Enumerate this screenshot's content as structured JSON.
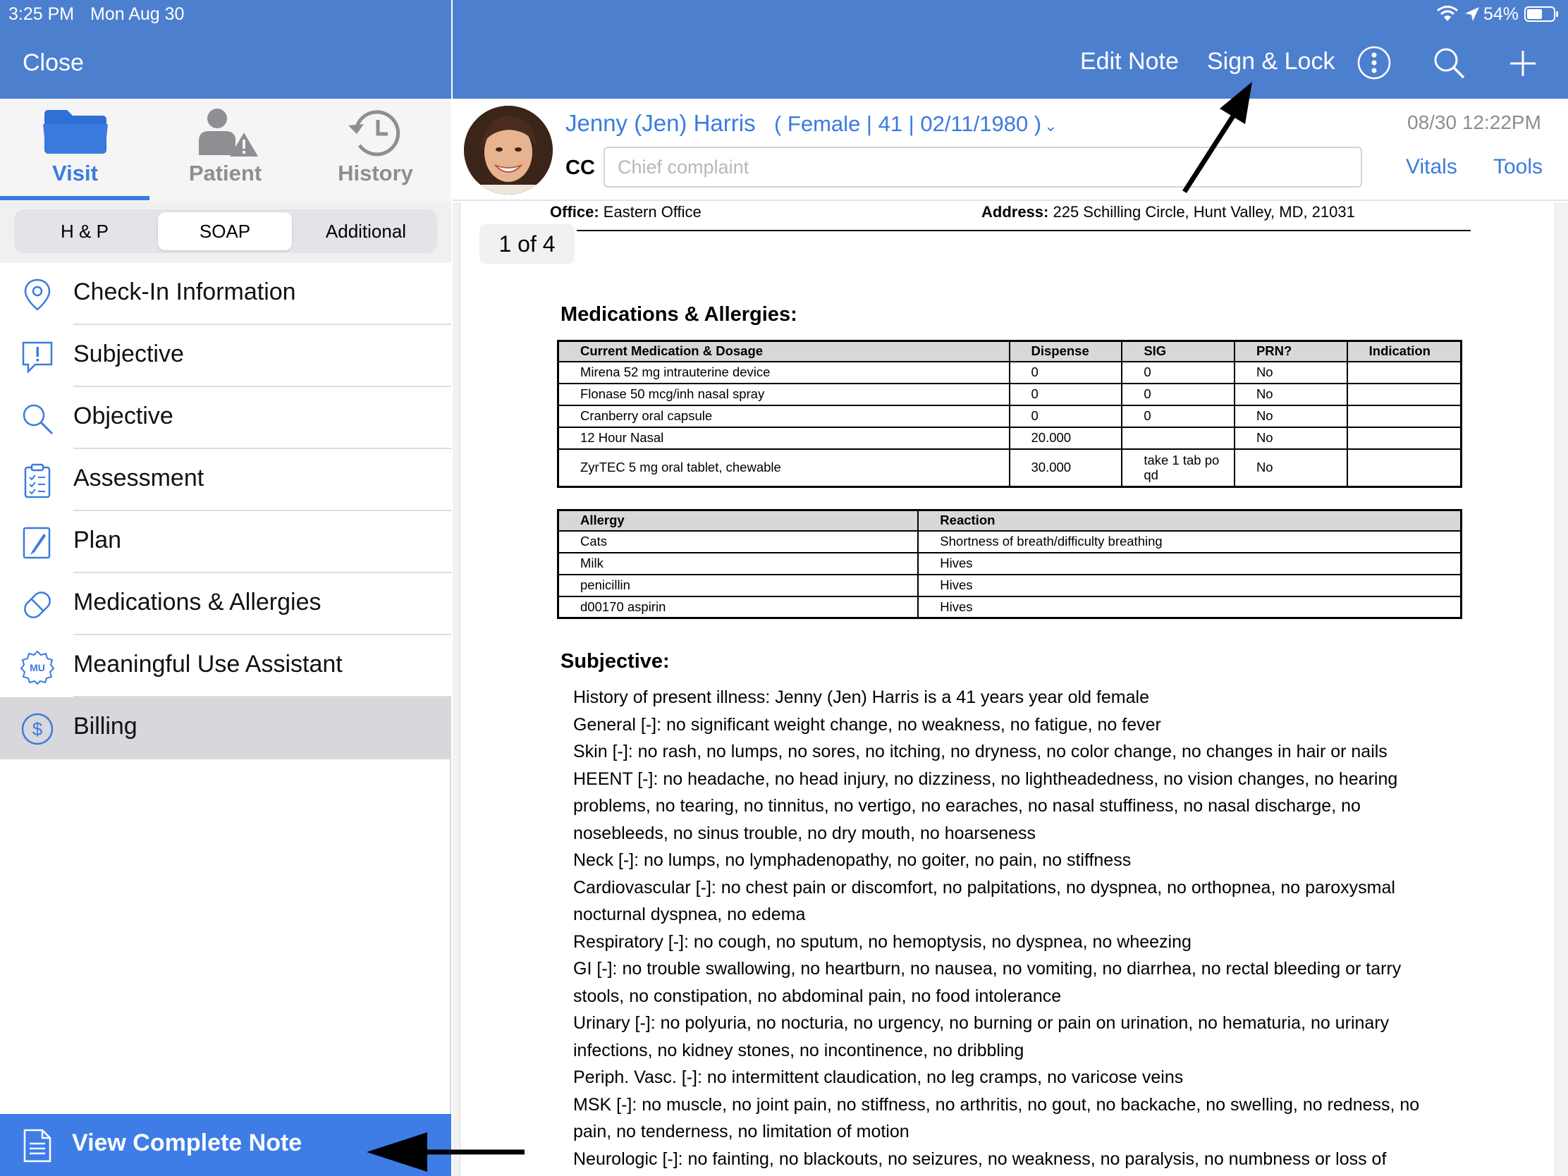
{
  "status": {
    "time": "3:25 PM",
    "date": "Mon Aug 30",
    "battery": "54%"
  },
  "left": {
    "close_label": "Close",
    "tabs": [
      {
        "label": "Visit"
      },
      {
        "label": "Patient"
      },
      {
        "label": "History"
      }
    ],
    "segments": [
      {
        "label": "H & P"
      },
      {
        "label": "SOAP"
      },
      {
        "label": "Additional"
      }
    ],
    "selected_segment": "SOAP",
    "nav_items": [
      {
        "label": "Check-In Information",
        "icon": "location-pin-icon"
      },
      {
        "label": "Subjective",
        "icon": "speech-bubble-exclamation-icon"
      },
      {
        "label": "Objective",
        "icon": "magnifier-icon"
      },
      {
        "label": "Assessment",
        "icon": "clipboard-checklist-icon"
      },
      {
        "label": "Plan",
        "icon": "pen-icon"
      },
      {
        "label": "Medications & Allergies",
        "icon": "pill-icon"
      },
      {
        "label": "Meaningful Use Assistant",
        "icon": "mu-badge-icon"
      },
      {
        "label": "Billing",
        "icon": "dollar-circle-icon"
      }
    ],
    "selected_nav": "Billing",
    "view_note_label": "View Complete Note"
  },
  "header": {
    "edit_note": "Edit Note",
    "sign_lock": "Sign & Lock"
  },
  "patient": {
    "name": "Jenny (Jen) Harris",
    "demographics": "( Female | 41 | 02/11/1980 )",
    "visit_datetime": "08/30 12:22PM",
    "cc_label": "CC",
    "cc_placeholder": "Chief complaint",
    "vitals_label": "Vitals",
    "tools_label": "Tools"
  },
  "doc": {
    "page_indicator": "1 of 4",
    "office_label": "Office:",
    "office_value": " Eastern Office",
    "address_label": "Address:",
    "address_value": " 225 Schilling Circle, Hunt Valley, MD, 21031",
    "med_title": "Medications & Allergies:",
    "med_headers": [
      "Current Medication & Dosage",
      "Dispense",
      "SIG",
      "PRN?",
      "Indication"
    ],
    "meds": [
      [
        "Mirena 52 mg intrauterine device",
        "0",
        "0",
        "No",
        ""
      ],
      [
        "Flonase 50 mcg/inh nasal spray",
        "0",
        "0",
        "No",
        ""
      ],
      [
        "Cranberry oral capsule",
        "0",
        "0",
        "No",
        ""
      ],
      [
        "12 Hour Nasal",
        "20.000",
        "",
        "No",
        ""
      ],
      [
        "ZyrTEC 5 mg oral tablet, chewable",
        "30.000",
        "take 1 tab po qd",
        "No",
        ""
      ]
    ],
    "allergy_headers": [
      "Allergy",
      "Reaction"
    ],
    "allergies": [
      [
        "Cats",
        "Shortness of breath/difficulty breathing"
      ],
      [
        "Milk",
        "Hives"
      ],
      [
        "penicillin",
        "Hives"
      ],
      [
        "d00170 aspirin",
        "Hives"
      ]
    ],
    "subj_title": "Subjective:",
    "subj_lines": [
      "History of present illness: Jenny (Jen) Harris is a 41 years year old female",
      "General [-]: no significant weight change, no weakness, no fatigue, no fever",
      "Skin [-]: no rash, no lumps, no sores, no itching, no dryness, no color change, no changes in hair or nails",
      "HEENT [-]: no headache, no head injury, no dizziness, no lightheadedness, no vision changes, no hearing",
      "problems, no tearing, no tinnitus, no vertigo, no earaches, no nasal stuffiness, no nasal discharge, no",
      "nosebleeds, no sinus trouble, no dry mouth, no hoarseness",
      "Neck [-]: no lumps, no lymphadenopathy, no goiter, no pain, no stiffness",
      "Cardiovascular [-]: no chest pain or discomfort, no palpitations, no dyspnea, no orthopnea, no paroxysmal",
      "nocturnal dyspnea, no edema",
      "Respiratory [-]: no cough, no sputum, no hemoptysis, no dyspnea, no wheezing",
      "GI [-]: no trouble swallowing, no heartburn, no nausea, no vomiting, no diarrhea, no rectal bleeding or tarry",
      "stools, no constipation, no abdominal pain, no food intolerance",
      "Urinary [-]: no polyuria, no nocturia, no urgency, no burning or pain on urination, no hematuria, no urinary",
      "infections, no kidney stones, no incontinence, no dribbling",
      "Periph. Vasc. [-]: no intermittent claudication, no leg cramps, no varicose veins",
      "MSK [-]: no muscle, no joint pain, no stiffness, no arthritis, no gout, no backache, no swelling, no redness, no",
      "pain, no tenderness, no limitation of motion",
      "Neurologic [-]: no fainting, no blackouts, no seizures, no weakness, no paralysis, no numbness or loss of"
    ]
  },
  "colors": {
    "header_blue": "#4d7fcf",
    "accent_blue": "#3a7be0",
    "selected_row": "#d7d7dc",
    "view_note_bg": "#3e7de6"
  }
}
